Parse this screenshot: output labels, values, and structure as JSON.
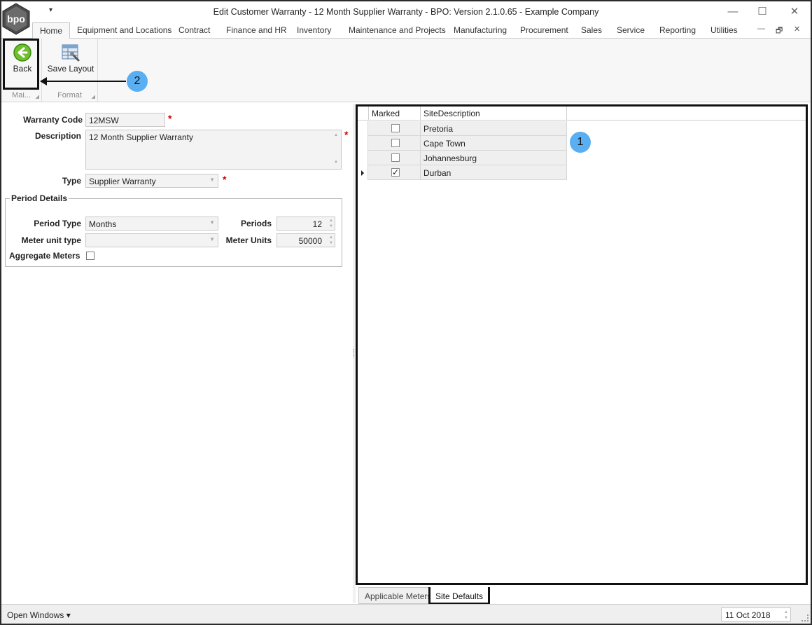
{
  "window": {
    "title": "Edit Customer Warranty - 12 Month Supplier Warranty - BPO: Version 2.1.0.65 - Example Company",
    "logo_text": "bpo",
    "qat_glyph": "▾",
    "minimize": "—",
    "maximize": "☐",
    "close": "✕"
  },
  "tabs": [
    {
      "label": "Home"
    },
    {
      "label": "Equipment and Locations"
    },
    {
      "label": "Contract"
    },
    {
      "label": "Finance and HR"
    },
    {
      "label": "Inventory"
    },
    {
      "label": "Maintenance and Projects"
    },
    {
      "label": "Manufacturing"
    },
    {
      "label": "Procurement"
    },
    {
      "label": "Sales"
    },
    {
      "label": "Service"
    },
    {
      "label": "Reporting"
    },
    {
      "label": "Utilities"
    }
  ],
  "mdi": {
    "minimize": "—",
    "restore": "🗗",
    "close": "✕"
  },
  "ribbon": {
    "back_label": "Back",
    "main_group_label": "Mai...",
    "save_layout_label": "Save Layout",
    "format_group_label": "Format"
  },
  "callouts": {
    "one": "1",
    "two": "2"
  },
  "form": {
    "warranty_code_label": "Warranty Code",
    "warranty_code_value": "12MSW",
    "description_label": "Description",
    "description_value": "12 Month Supplier Warranty",
    "type_label": "Type",
    "type_value": "Supplier Warranty",
    "required_mark": "*",
    "period_details_title": "Period Details",
    "period_type_label": "Period Type",
    "period_type_value": "Months",
    "periods_label": "Periods",
    "periods_value": "12",
    "meter_unit_type_label": "Meter unit type",
    "meter_unit_type_value": "",
    "meter_units_label": "Meter Units",
    "meter_units_value": "50000",
    "aggregate_meters_label": "Aggregate Meters",
    "aggregate_meters_checked": false
  },
  "grid": {
    "columns": [
      "Marked",
      "SiteDescription"
    ],
    "rows": [
      {
        "marked": false,
        "site": "Pretoria"
      },
      {
        "marked": false,
        "site": "Cape Town"
      },
      {
        "marked": false,
        "site": "Johannesburg"
      },
      {
        "marked": true,
        "site": "Durban"
      }
    ]
  },
  "bottom_tabs": {
    "applicable_meters": "Applicable Meters",
    "site_defaults": "Site Defaults"
  },
  "status": {
    "open_windows": "Open Windows ▾",
    "date": "11 Oct 2018"
  }
}
